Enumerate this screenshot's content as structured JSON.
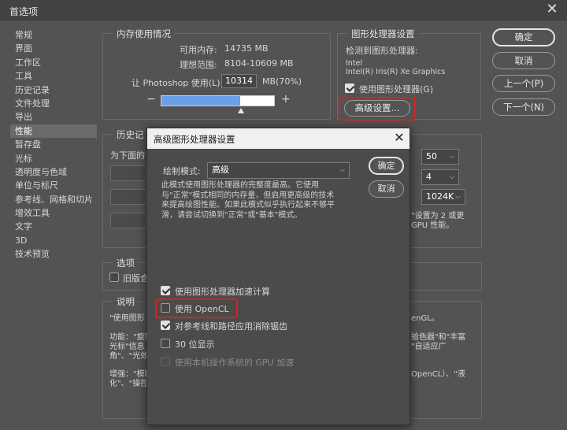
{
  "window": {
    "title": "首选项"
  },
  "nav": {
    "items": [
      "常规",
      "界面",
      "工作区",
      "工具",
      "历史记录",
      "文件处理",
      "导出",
      "性能",
      "暂存盘",
      "光标",
      "透明度与色域",
      "单位与标尺",
      "参考线、网格和切片",
      "增效工具",
      "文字",
      "3D",
      "技术预览"
    ],
    "selected": "性能"
  },
  "memory": {
    "title": "内存使用情况",
    "available_label": "可用内存:",
    "available_value": "14735 MB",
    "ideal_label": "理想范围:",
    "ideal_value": "8104-10609 MB",
    "use_label": "让 Photoshop 使用(L):",
    "use_value": "10314",
    "use_pct": "MB(70%)",
    "minus": "−",
    "plus": "+",
    "slider_fill": 0.7
  },
  "gpu": {
    "title": "图形处理器设置",
    "detected_label": "检测到图形处理器:",
    "vendor": "Intel",
    "model": "Intel(R) Iris(R) Xe Graphics",
    "use_gpu_label": "使用图形处理器(G)",
    "advanced_btn": "高级设置..."
  },
  "history": {
    "title": "历史记",
    "for_below": "为下面的",
    "history_states": "50",
    "cache_levels": "4",
    "tile_size": "1024K",
    "note_line1": "\"设置为 2 或更",
    "note_line2": "GPU 性能。"
  },
  "options": {
    "title": "选项",
    "legacy_label": "旧版合"
  },
  "description": {
    "title": "说明",
    "line1": "\"使用图形",
    "line1_right": "enGL。",
    "features_line1": "功能：\"旋转",
    "features_right1": "拾色器\"和\"丰富",
    "features_line2": "光标\"信息",
    "features_right2": "\"自适应广",
    "features_line3": "角\"、\"光效",
    "enhance_line1": "增强：\"模糊",
    "enhance_right1": "OpenCL）、\"液",
    "enhance_line2": "化\"、\"操控变形"
  },
  "side_buttons": {
    "ok": "确定",
    "cancel": "取消",
    "prev": "上一个(P)",
    "next": "下一个(N)"
  },
  "modal": {
    "title": "高级图形处理器设置",
    "draw_mode_label": "绘制模式:",
    "draw_mode_value": "高级",
    "ok": "确定",
    "cancel": "取消",
    "desc_lines": [
      "此模式使用图形处理器的完整度最高。它使用",
      "与\"正常\"模式相同的内存量，但启用更高级的技术",
      "来提高绘图性能。如果此模式似乎执行起来不够平",
      "滑，请尝试切换到\"正常\"或\"基本\"模式。"
    ],
    "opt_gpu_compute": "使用图形处理器加速计算",
    "opt_opencl": "使用 OpenCL",
    "opt_antialias": "对参考线和路径应用消除锯齿",
    "opt_30bit": "30 位显示",
    "opt_native_gpu": "使用本机操作系统的 GPU 加速"
  },
  "colors": {
    "accent_red": "#e01e1e",
    "panel": "#535353",
    "selected": "#6a6a6a",
    "slider_blue": "#6aa0e8"
  }
}
